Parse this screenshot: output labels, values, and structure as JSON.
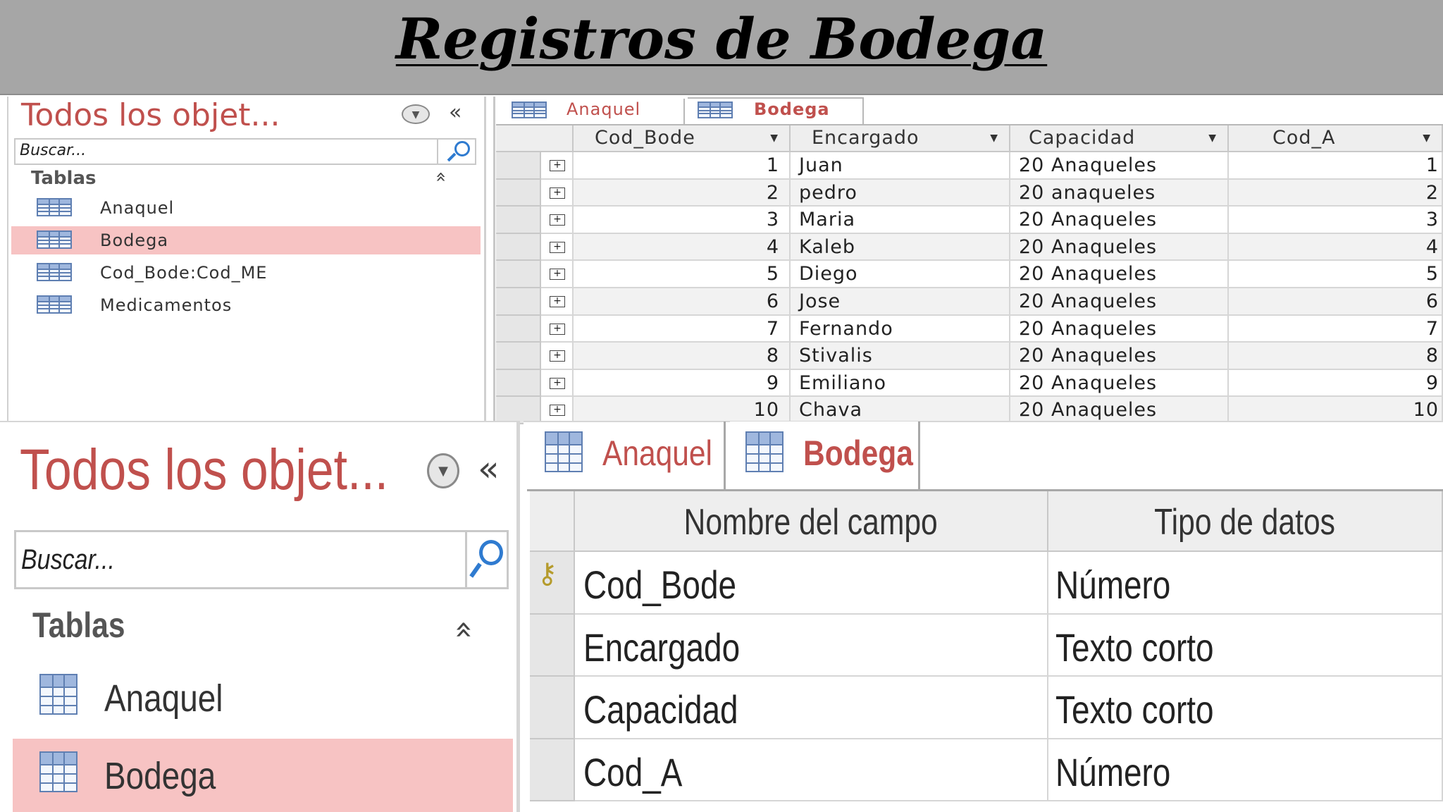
{
  "banner": {
    "title": "Registros de Bodega"
  },
  "nav_small": {
    "title": "Todos los objet...",
    "search_placeholder": "Buscar...",
    "section": "Tablas",
    "items": [
      "Anaquel",
      "Bodega",
      "Cod_Bode:Cod_ME",
      "Medicamentos"
    ],
    "selected": "Bodega"
  },
  "datasheet": {
    "tabs": [
      "Anaquel",
      "Bodega"
    ],
    "active_tab": "Bodega",
    "columns": [
      "Cod_Bode",
      "Encargado",
      "Capacidad",
      "Cod_A"
    ],
    "rows": [
      [
        "1",
        "Juan",
        "20 Anaqueles",
        "1"
      ],
      [
        "2",
        "pedro",
        "20 anaqueles",
        "2"
      ],
      [
        "3",
        "Maria",
        "20 Anaqueles",
        "3"
      ],
      [
        "4",
        "Kaleb",
        "20 Anaqueles",
        "4"
      ],
      [
        "5",
        "Diego",
        "20 Anaqueles",
        "5"
      ],
      [
        "6",
        "Jose",
        "20 Anaqueles",
        "6"
      ],
      [
        "7",
        "Fernando",
        "20 Anaqueles",
        "7"
      ],
      [
        "8",
        "Stivalis",
        "20 Anaqueles",
        "8"
      ],
      [
        "9",
        "Emiliano",
        "20 Anaqueles",
        "9"
      ],
      [
        "10",
        "Chava",
        "20 Anaqueles",
        "10"
      ]
    ]
  },
  "nav_large": {
    "title": "Todos los objet...",
    "search_placeholder": "Buscar...",
    "section": "Tablas",
    "items": [
      "Anaquel",
      "Bodega"
    ],
    "selected": "Bodega"
  },
  "design": {
    "tabs": [
      "Anaquel",
      "Bodega"
    ],
    "active_tab": "Bodega",
    "headers": [
      "Nombre del campo",
      "Tipo de datos"
    ],
    "fields": [
      {
        "name": "Cod_Bode",
        "type": "Número",
        "primary_key": true
      },
      {
        "name": "Encargado",
        "type": "Texto corto",
        "primary_key": false
      },
      {
        "name": "Capacidad",
        "type": "Texto corto",
        "primary_key": false
      },
      {
        "name": "Cod_A",
        "type": "Número",
        "primary_key": false
      }
    ]
  },
  "colors": {
    "accent_red": "#c0504d",
    "selection": "#f7c3c3",
    "banner": "#a6a6a6"
  }
}
